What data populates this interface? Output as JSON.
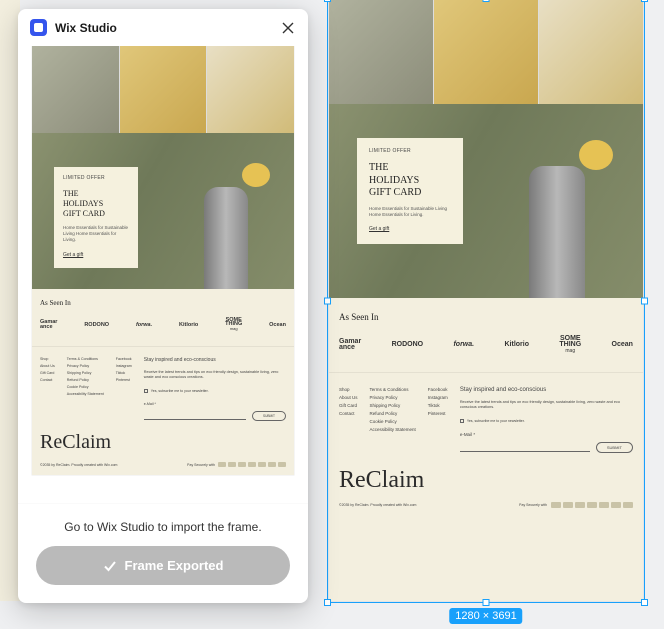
{
  "modal": {
    "title": "Wix Studio",
    "hint": "Go to Wix Studio to import the frame.",
    "button_label": "Frame Exported"
  },
  "selection": {
    "dimensions": "1280 × 3691"
  },
  "page": {
    "hero": {
      "eyebrow": "LIMITED OFFER",
      "title_line1": "THE",
      "title_line2": "HOLIDAYS",
      "title_line3": "GIFT CARD",
      "desc": "Home Essentials for Sustainable Living Home Essentials for Living.",
      "cta": "Get a gift"
    },
    "asseen": {
      "title": "As Seen In",
      "logos": [
        "Gamar\nance",
        "RODONO",
        "forwa.",
        "Kitlorio",
        "SOME\nTHING\nmag",
        "Ocean"
      ]
    },
    "footer": {
      "col1": [
        "Shop",
        "About Us",
        "Gift Card",
        "Contact"
      ],
      "col2": [
        "Terms & Conditions",
        "Privacy Policy",
        "Shipping Policy",
        "Refund Policy",
        "Cookie Policy",
        "Accessibility Statement"
      ],
      "col3": [
        "Facebook",
        "Instagram",
        "Tiktok",
        "Pinterest"
      ],
      "news_title": "Stay inspired and eco-conscious",
      "news_desc": "Receive the latest trends and tips on eco friendly design, sustainable living, zero waste and eco conscious creations.",
      "check_label": "Yes, subscribe me to your newsletter.",
      "email_label": "e-Mail *",
      "submit": "SUBMIT",
      "logo": "ReClaim",
      "copyright": "©2035 by ReClaim. Proudly created with Wix.com",
      "pay_label": "Pay Securely with"
    }
  }
}
